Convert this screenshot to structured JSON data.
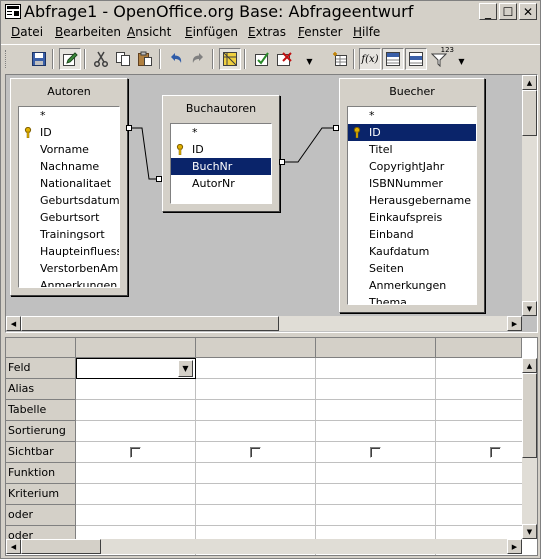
{
  "window": {
    "title": "Abfrage1 - OpenOffice.org Base: Abfrageentwurf",
    "minimize_glyph": "_",
    "maximize_glyph": "☐",
    "close_glyph": "✕"
  },
  "menu": {
    "items": [
      {
        "underline": "D",
        "rest": "atei"
      },
      {
        "underline": "B",
        "rest": "earbeiten"
      },
      {
        "underline": "A",
        "rest": "nsicht"
      },
      {
        "underline": "E",
        "rest": "infügen"
      },
      {
        "underline": "E",
        "rest": "xtras"
      },
      {
        "underline": "F",
        "rest": "enster"
      },
      {
        "underline": "H",
        "rest": "ilfe"
      }
    ]
  },
  "toolbar": {
    "icons": [
      "save-icon",
      "edit-icon",
      "cut-icon",
      "copy-icon",
      "paste-icon",
      "undo-icon",
      "redo-icon",
      "design-view-icon",
      "run-query-icon",
      "clear-query-icon",
      "add-table-icon",
      "functions-icon",
      "table-name-icon",
      "alias-icon",
      "distinct-icon"
    ],
    "functions_label": "f(x)",
    "distinct_label": "123"
  },
  "tables": {
    "autoren": {
      "title": "Autoren",
      "fields": [
        "*",
        "ID",
        "Vorname",
        "Nachname",
        "Nationalitaet",
        "Geburtsdatum",
        "Geburtsort",
        "Trainingsort",
        "Haupteinfluesse",
        "VerstorbenAm",
        "Anmerkungen"
      ]
    },
    "buchautoren": {
      "title": "Buchautoren",
      "fields": [
        "*",
        "ID",
        "BuchNr",
        "AutorNr"
      ],
      "selected": "BuchNr"
    },
    "buecher": {
      "title": "Buecher",
      "fields": [
        "*",
        "ID",
        "Titel",
        "CopyrightJahr",
        "ISBNNummer",
        "Herausgebername",
        "Einkaufspreis",
        "Einband",
        "Kaufdatum",
        "Seiten",
        "Anmerkungen",
        "Thema"
      ],
      "selected": "ID"
    }
  },
  "grid": {
    "row_labels": [
      "Feld",
      "Alias",
      "Tabelle",
      "Sortierung",
      "Sichtbar",
      "Funktion",
      "Kriterium",
      "oder",
      "oder"
    ],
    "column_count": 4
  },
  "colors": {
    "selection": "#0a246a",
    "key_icon": "#c8a000",
    "background": "#d4d0c8",
    "design_area": "#c0c0c0"
  }
}
